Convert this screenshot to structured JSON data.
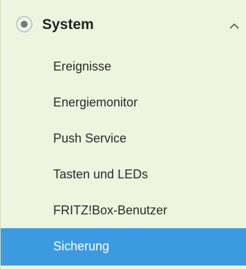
{
  "sidebar": {
    "section": {
      "title": "System",
      "icon": "radio-dot-icon",
      "toggle_icon": "chevron-up-icon"
    },
    "items": [
      {
        "label": "Ereignisse"
      },
      {
        "label": "Energiemonitor"
      },
      {
        "label": "Push Service"
      },
      {
        "label": "Tasten und LEDs"
      },
      {
        "label": "FRITZ!Box-Benutzer"
      },
      {
        "label": "Sicherung",
        "active": true
      }
    ]
  },
  "colors": {
    "background": "#eef5df",
    "active_background": "#3c9ae0",
    "text": "#2a2a2a",
    "active_text": "#ffffff",
    "icon_ring": "#c2c9d1",
    "icon_dot": "#6f7a85"
  }
}
